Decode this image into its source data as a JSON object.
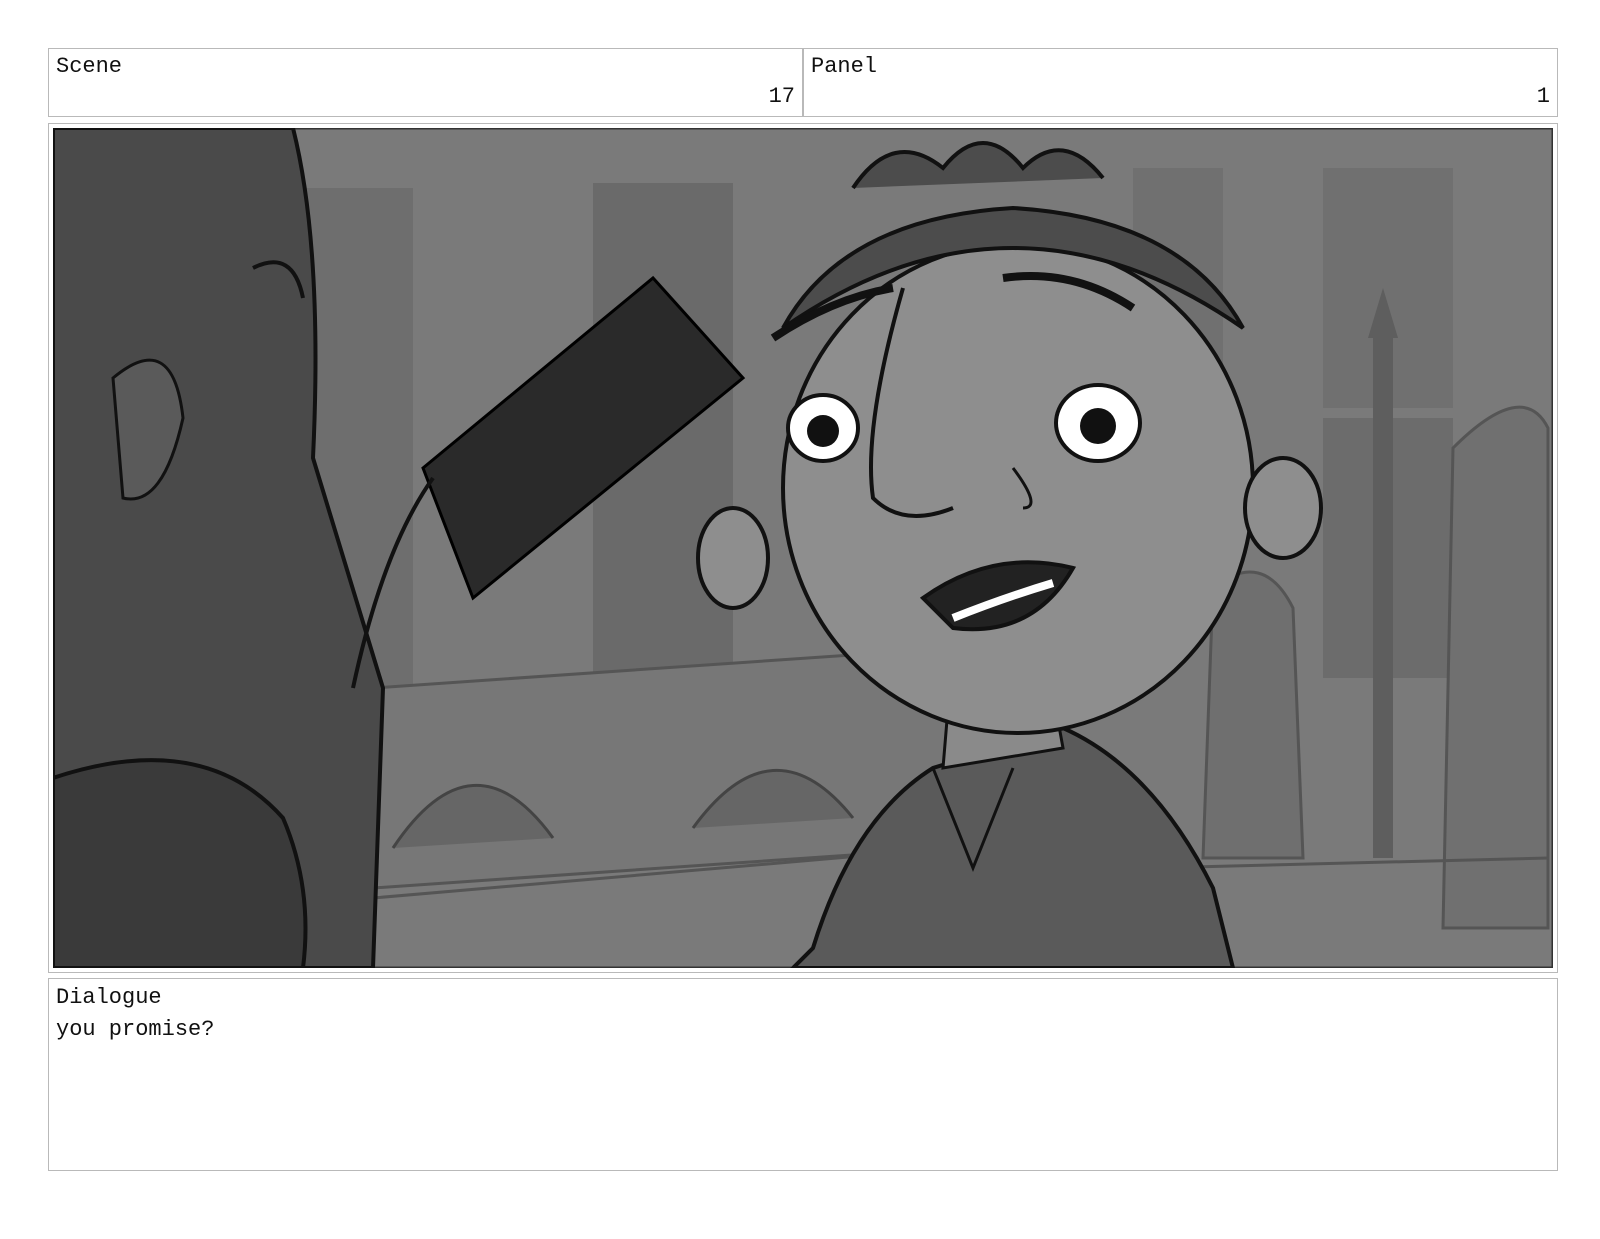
{
  "scene": {
    "label": "Scene",
    "number": "17"
  },
  "panel": {
    "label": "Panel",
    "number": "1"
  },
  "frame": {
    "description_icon": "storyboard-sketch-image"
  },
  "dialogue": {
    "label": "Dialogue",
    "text": "you promise?"
  }
}
